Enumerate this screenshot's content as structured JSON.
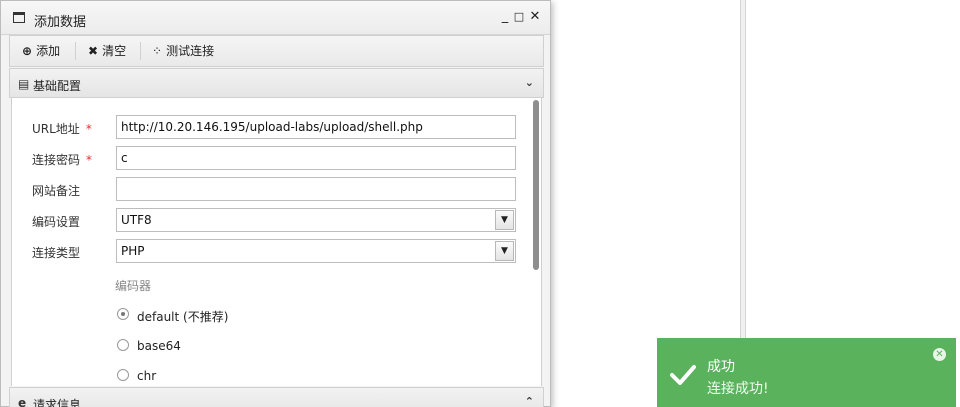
{
  "window": {
    "title": "添加数据",
    "minimize_glyph": "_",
    "maximize_glyph": "□",
    "close_glyph": "✕"
  },
  "toolbar": {
    "add": {
      "icon": "plus-circle-icon",
      "glyph": "⊕",
      "label": "添加"
    },
    "clear": {
      "icon": "x-icon",
      "glyph": "✖",
      "label": "清空"
    },
    "test": {
      "icon": "spinner-icon",
      "glyph": "⁘",
      "label": "测试连接"
    }
  },
  "sections": {
    "basic": {
      "icon": "document-icon",
      "glyph": "▤",
      "label": "基础配置",
      "chevron": "⌄"
    },
    "request": {
      "icon": "edge-icon",
      "glyph": "e",
      "label": "请求信息",
      "chevron": "⌃"
    }
  },
  "form": {
    "url": {
      "label": "URL地址",
      "required_mark": "*",
      "value": "http://10.20.146.195/upload-labs/upload/shell.php"
    },
    "password": {
      "label": "连接密码",
      "required_mark": "*",
      "value": "c"
    },
    "note": {
      "label": "网站备注",
      "value": ""
    },
    "encoding": {
      "label": "编码设置",
      "value": "UTF8"
    },
    "type": {
      "label": "连接类型",
      "value": "PHP"
    },
    "encoder": {
      "label": "编码器",
      "options": [
        "default (不推荐)",
        "base64",
        "chr"
      ],
      "selected": "default (不推荐)"
    }
  },
  "toast": {
    "title": "成功",
    "message": "连接成功!",
    "color": "#5ab25c"
  }
}
